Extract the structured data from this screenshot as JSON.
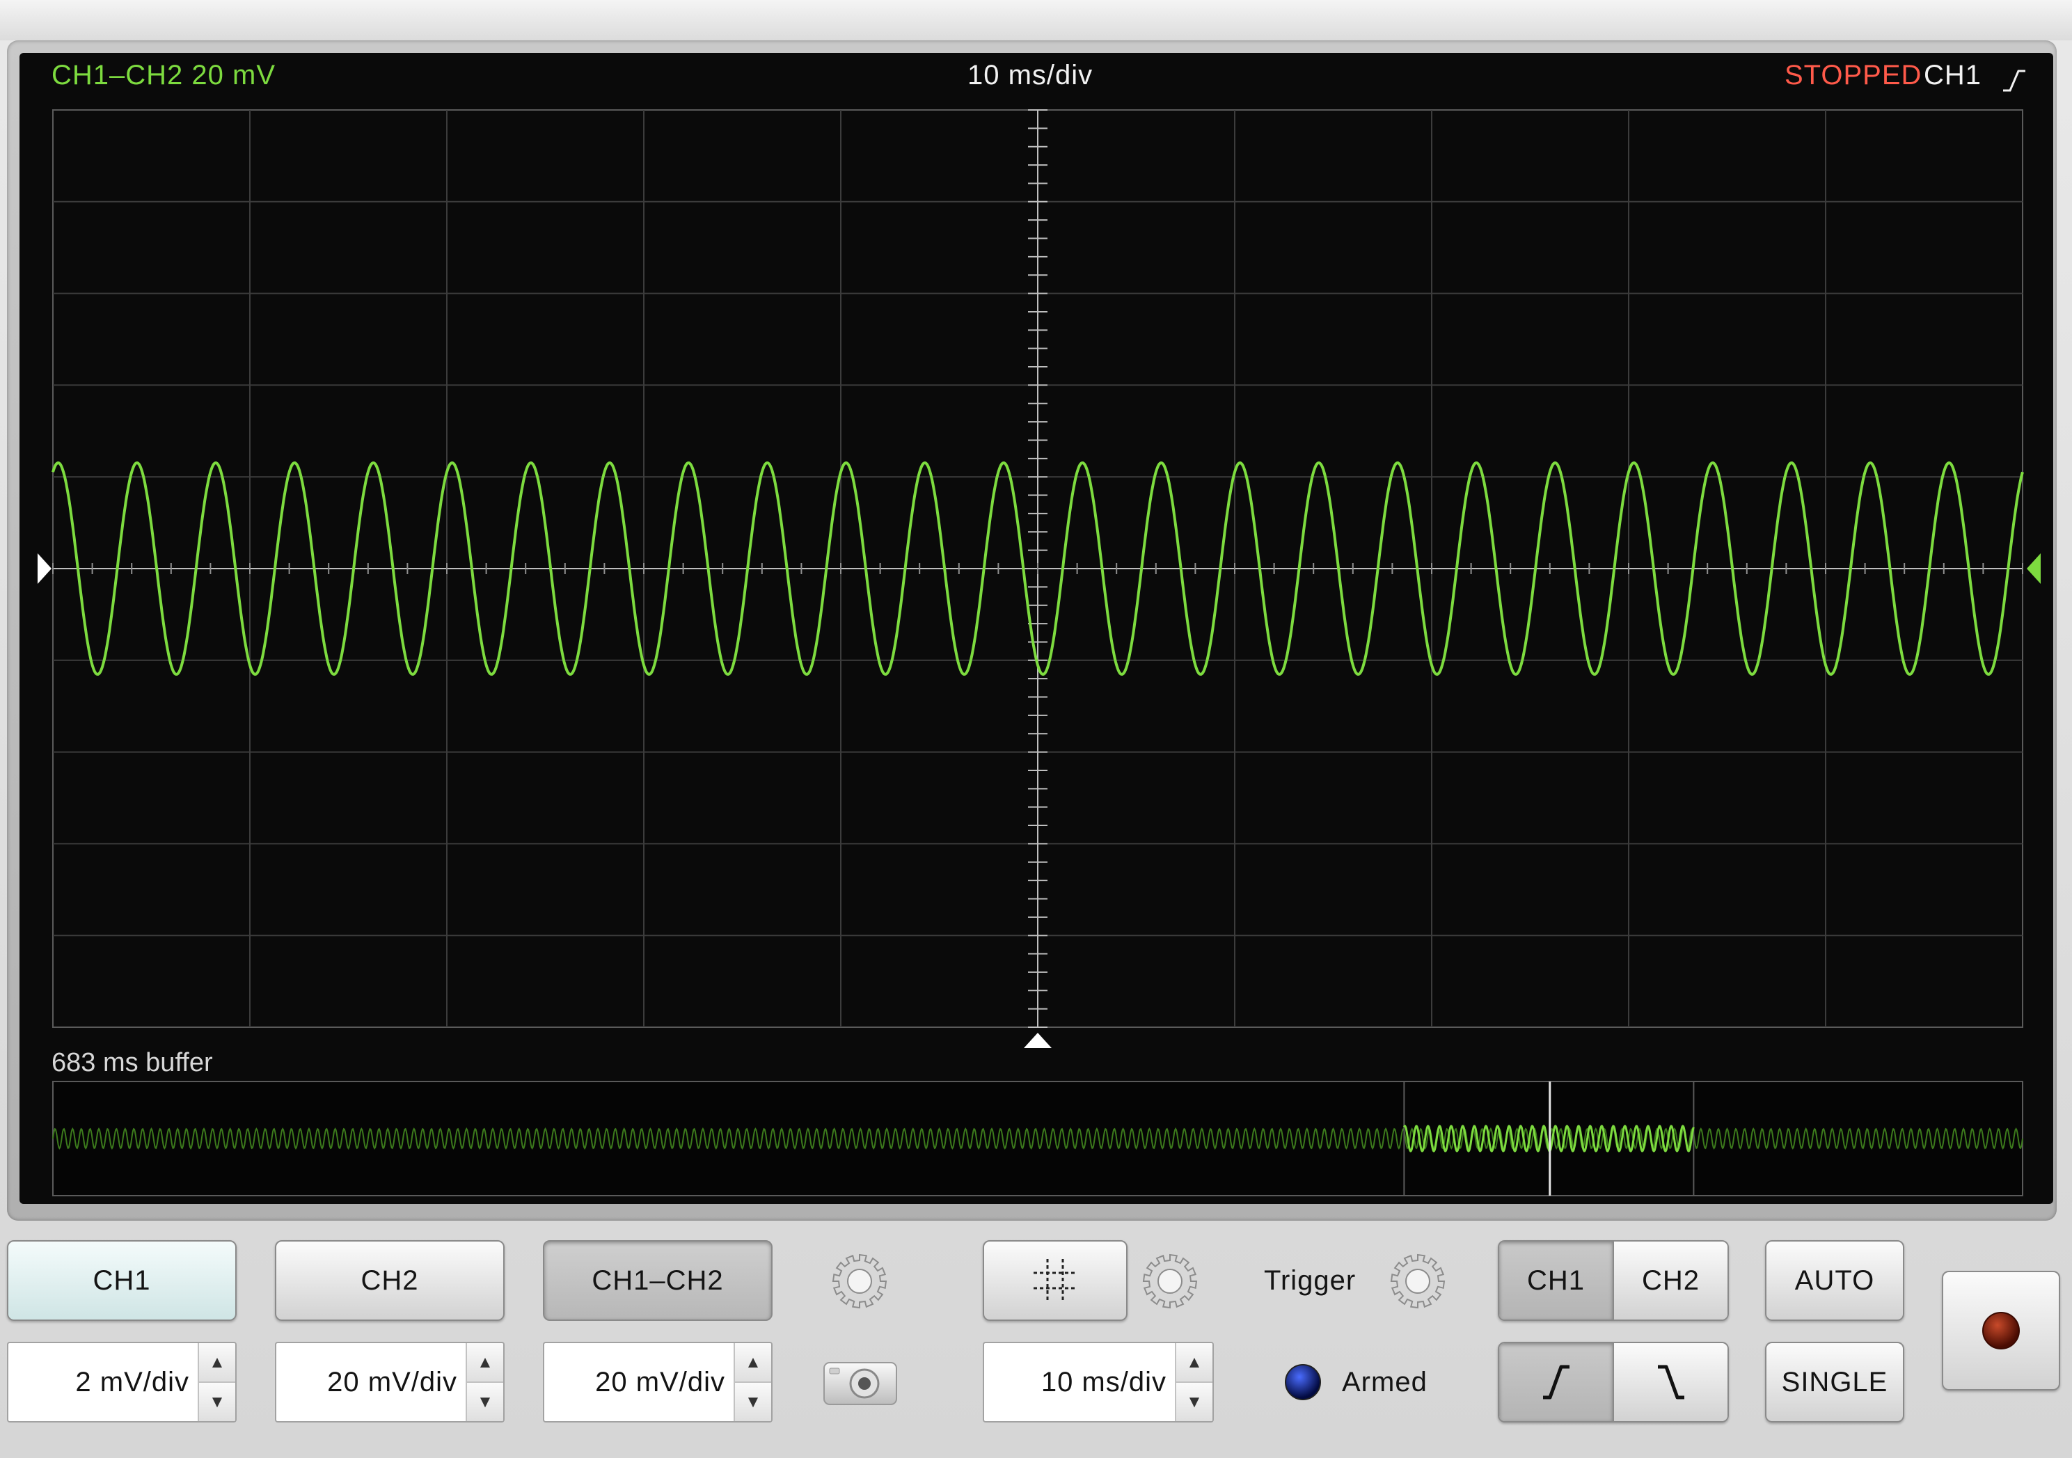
{
  "display": {
    "channel_label": "CH1–CH2 20 mV",
    "timebase_label": "10 ms/div",
    "status": "STOPPED",
    "trigger_source": "CH1",
    "buffer_label": "683 ms buffer"
  },
  "colors": {
    "trace": "#7ddb3f",
    "status": "#ff5a4a",
    "screen": "#0a0a0a",
    "grid": "#5a5a5a"
  },
  "buttons": {
    "ch1": "CH1",
    "ch2": "CH2",
    "ch1_ch2": "CH1–CH2",
    "auto": "AUTO",
    "single": "SINGLE"
  },
  "steppers": {
    "ch1_scale": "2 mV/div",
    "ch2_scale": "20 mV/div",
    "diff_scale": "20 mV/div",
    "timebase": "10 ms/div"
  },
  "trigger": {
    "label": "Trigger",
    "status": "Armed",
    "source_options": [
      "CH1",
      "CH2"
    ],
    "selected_source": "CH1",
    "slope_selected": "rising"
  },
  "icons": {
    "gear": "gear-icon",
    "camera": "camera-icon",
    "cursor": "cursor-crosshair-icon",
    "record": "record-icon"
  }
}
